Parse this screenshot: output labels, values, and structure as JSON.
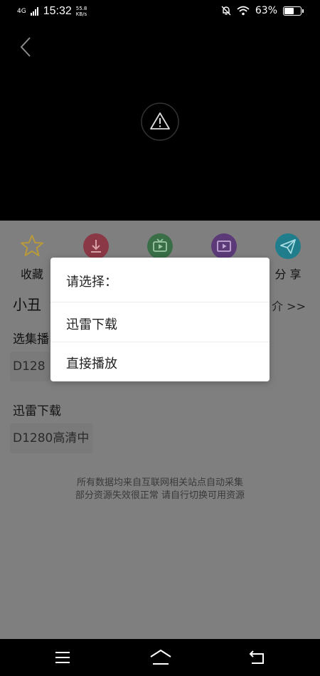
{
  "status_bar": {
    "network": "4G",
    "time": "15:32",
    "speed_value": "55.8",
    "speed_unit": "KB/s",
    "battery_pct": "63%",
    "battery_level": 0.63
  },
  "actions": [
    {
      "label": "收藏",
      "icon": "star-icon",
      "color": "#b8a04a"
    },
    {
      "label": "",
      "icon": "download-icon",
      "color": "#9a3a4a"
    },
    {
      "label": "",
      "icon": "tv-icon",
      "color": "#3b7a4a"
    },
    {
      "label": "",
      "icon": "film-icon",
      "color": "#5a3a7a"
    },
    {
      "label": "分 享",
      "icon": "send-icon",
      "color": "#1f7a8a"
    }
  ],
  "video": {
    "title": "小丑",
    "intro_link": "介 >>",
    "episode_label": "选集播",
    "episode_chip": "D128",
    "xunlei_label": "迅雷下载",
    "xunlei_chip": "D1280高清中"
  },
  "disclaimer": {
    "line1": "所有数据均来自互联网相关站点自动采集",
    "line2": "部分资源失效很正常 请自行切换可用资源"
  },
  "dialog": {
    "title": "请选择：",
    "options": [
      "迅雷下载",
      "直接播放"
    ]
  },
  "colors": {
    "overlay": "#7f7f7f",
    "dialog_bg": "#ffffff"
  }
}
